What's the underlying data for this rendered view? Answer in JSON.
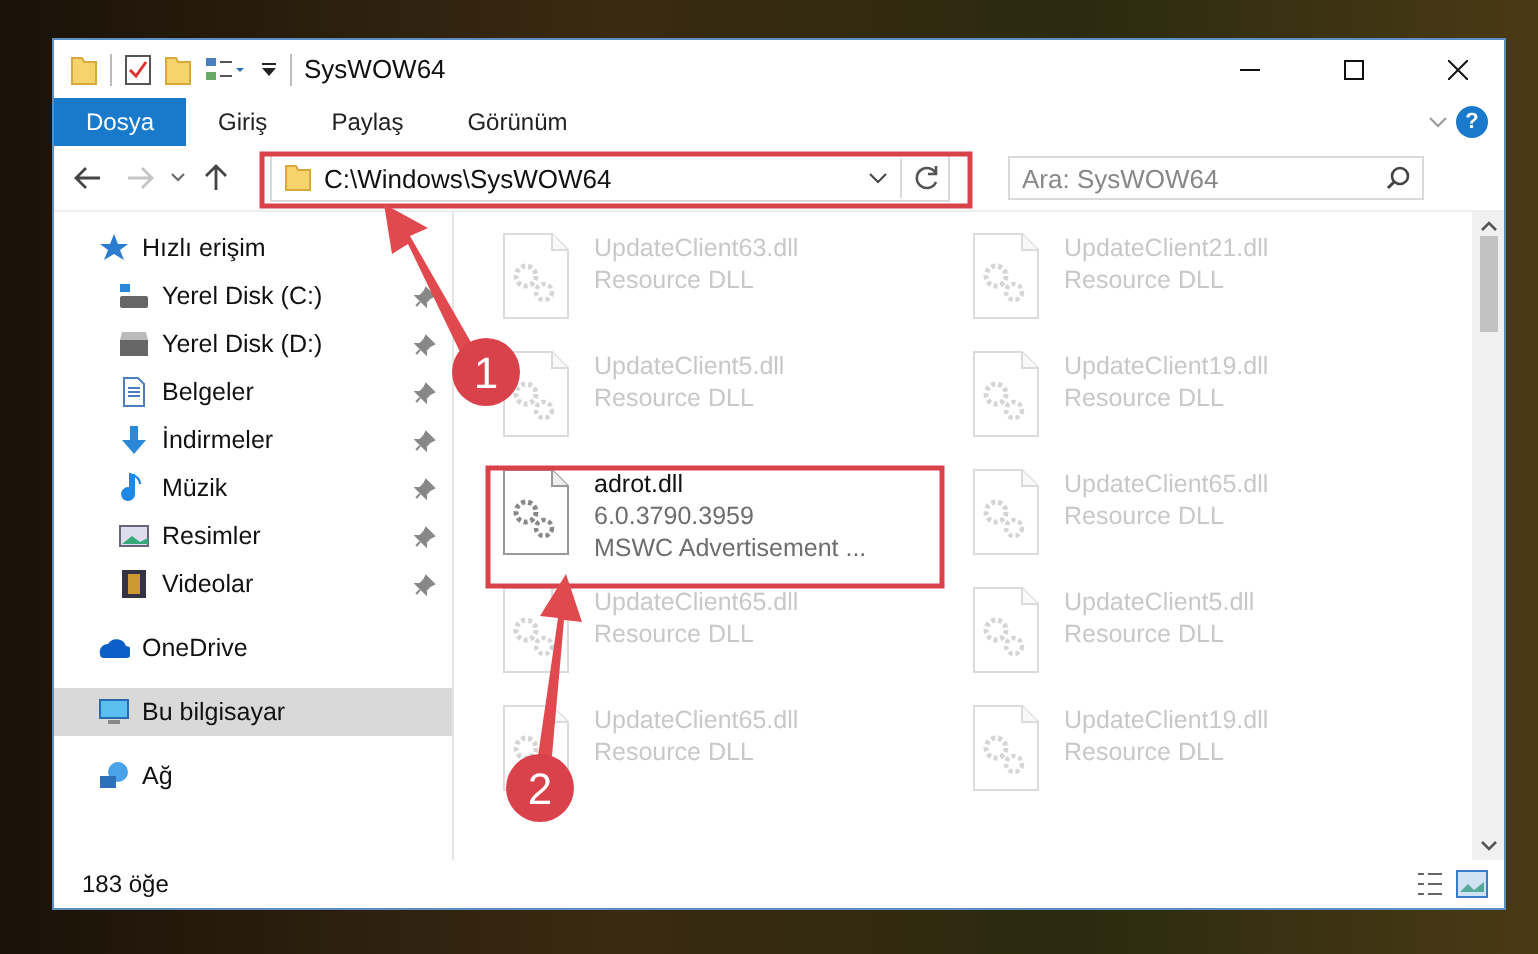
{
  "window": {
    "title": "SysWOW64"
  },
  "ribbon_tabs": [
    {
      "label": "Dosya",
      "selected": true
    },
    {
      "label": "Giriş",
      "selected": false
    },
    {
      "label": "Paylaş",
      "selected": false
    },
    {
      "label": "Görünüm",
      "selected": false
    }
  ],
  "help": "?",
  "address_bar": {
    "path": "C:\\Windows\\SysWOW64",
    "forward_disabled": true
  },
  "search": {
    "placeholder": "Ara: SysWOW64"
  },
  "navigation": [
    {
      "label": "Hızlı erişim",
      "selected": false,
      "children": [
        {
          "label": "Yerel Disk (C:)",
          "pinned": true
        },
        {
          "label": "Yerel Disk (D:)",
          "pinned": true
        },
        {
          "label": "Belgeler",
          "pinned": true
        },
        {
          "label": "İndirmeler",
          "pinned": true
        },
        {
          "label": "Müzik",
          "pinned": true
        },
        {
          "label": "Resimler",
          "pinned": true
        },
        {
          "label": "Videolar",
          "pinned": true
        }
      ]
    },
    {
      "label": "OneDrive",
      "selected": false
    },
    {
      "label": "Bu bilgisayar",
      "selected": true
    },
    {
      "label": "Ağ",
      "selected": false
    }
  ],
  "files": [
    {
      "name": "UpdateClient63.dll",
      "details": [
        "Resource DLL"
      ],
      "dimmed": true
    },
    {
      "name": "UpdateClient21.dll",
      "details": [
        "Resource DLL"
      ],
      "dimmed": true
    },
    {
      "name": "UpdateClient5.dll",
      "details": [
        "Resource DLL"
      ],
      "dimmed": true
    },
    {
      "name": "UpdateClient19.dll",
      "details": [
        "Resource DLL"
      ],
      "dimmed": true
    },
    {
      "name": "adrot.dll",
      "details": [
        "6.0.3790.3959",
        "MSWC Advertisement ..."
      ],
      "dimmed": false
    },
    {
      "name": "UpdateClient65.dll",
      "details": [
        "Resource DLL"
      ],
      "dimmed": true
    },
    {
      "name": "UpdateClient65.dll",
      "details": [
        "Resource DLL"
      ],
      "dimmed": true
    },
    {
      "name": "UpdateClient5.dll",
      "details": [
        "Resource DLL"
      ],
      "dimmed": true
    },
    {
      "name": "UpdateClient65.dll",
      "details": [
        "Resource DLL"
      ],
      "dimmed": true
    },
    {
      "name": "UpdateClient19.dll",
      "details": [
        "Resource DLL"
      ],
      "dimmed": true
    }
  ],
  "status_bar": {
    "item_count": "183 öğe"
  },
  "annotations": [
    {
      "number": "1"
    },
    {
      "number": "2"
    }
  ]
}
